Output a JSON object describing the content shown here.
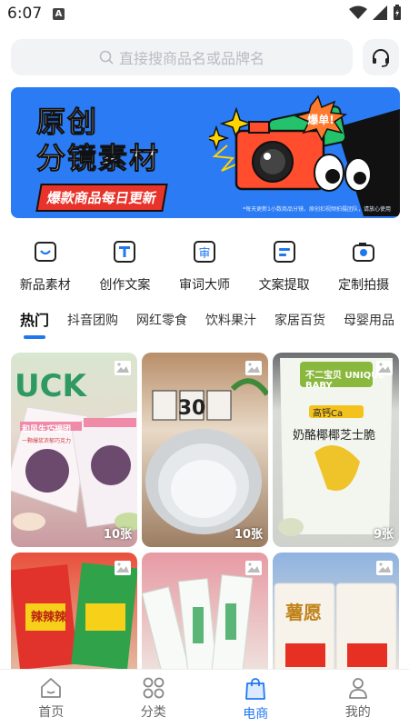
{
  "status": {
    "time": "6:07",
    "notification_glyph": "A"
  },
  "search": {
    "placeholder": "直接搜商品名或品牌名"
  },
  "banner": {
    "title_line1": "原创",
    "title_line2": "分镜素材",
    "strip": "爆款商品每日更新",
    "burst": "爆单!",
    "note": "*每天更新1小数商品分镜，原创扣视频拍摄团队，请放心使用"
  },
  "quick_actions": [
    {
      "label": "新品素材",
      "icon": "new-product-icon"
    },
    {
      "label": "创作文案",
      "icon": "text-doc-icon"
    },
    {
      "label": "审词大师",
      "icon": "review-icon"
    },
    {
      "label": "文案提取",
      "icon": "extract-icon"
    },
    {
      "label": "定制拍摄",
      "icon": "camera-icon"
    }
  ],
  "tabs": [
    "热门",
    "抖音团购",
    "网红零食",
    "饮料果汁",
    "家居百货",
    "母婴用品"
  ],
  "active_tab": "热门",
  "cards": [
    {
      "count": "10张",
      "caption": "和风生巧福团",
      "subcaption": "一颗爆浆浓郁巧克力"
    },
    {
      "count": "10张",
      "caption": "30",
      "subcaption": ""
    },
    {
      "count": "9张",
      "caption": "奶酪椰椰芝士脆",
      "subcaption": "高钙Ca",
      "brand": "不二宝贝 UNIQUE BABY"
    },
    {
      "count": "",
      "caption": "辣辣辣",
      "subcaption": ""
    },
    {
      "count": "",
      "caption": "",
      "subcaption": ""
    },
    {
      "count": "",
      "caption": "薯愿",
      "subcaption": ""
    }
  ],
  "bottom_nav": [
    {
      "label": "首页",
      "icon": "home-icon"
    },
    {
      "label": "分类",
      "icon": "category-icon"
    },
    {
      "label": "电商",
      "icon": "shopping-bag-icon"
    },
    {
      "label": "我的",
      "icon": "profile-icon"
    }
  ],
  "active_nav": "电商",
  "colors": {
    "accent": "#1f78f0",
    "banner": "#2a7bf4",
    "strip": "#e8332a",
    "search_bg": "#f2f3f5"
  }
}
